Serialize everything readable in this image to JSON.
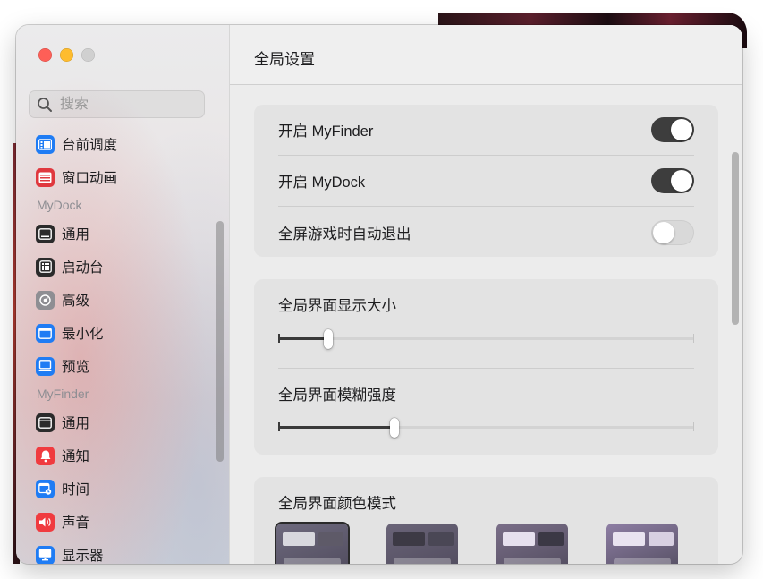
{
  "window": {
    "controls": [
      "close",
      "minimize",
      "zoom"
    ]
  },
  "sidebar": {
    "search_placeholder": "搜索",
    "items_top": [
      {
        "label": "台前调度",
        "icon": "stage-manager-icon",
        "color": "#1f7cf4"
      },
      {
        "label": "窗口动画",
        "icon": "window-animation-icon",
        "color": "#e0383e"
      }
    ],
    "section_dock": "MyDock",
    "items_dock": [
      {
        "label": "通用",
        "icon": "general-icon",
        "color": "#2b2b2b"
      },
      {
        "label": "启动台",
        "icon": "launchpad-icon",
        "color": "#2b2b2b"
      },
      {
        "label": "高级",
        "icon": "advanced-gear-icon",
        "color": "#8e8e93"
      },
      {
        "label": "最小化",
        "icon": "minimize-window-icon",
        "color": "#1f7cf4"
      },
      {
        "label": "预览",
        "icon": "preview-icon",
        "color": "#1f7cf4"
      }
    ],
    "section_finder": "MyFinder",
    "items_finder": [
      {
        "label": "通用",
        "icon": "general-icon",
        "color": "#2b2b2b"
      },
      {
        "label": "通知",
        "icon": "notification-bell-icon",
        "color": "#f03b3f"
      },
      {
        "label": "时间",
        "icon": "time-calendar-icon",
        "color": "#1f7cf4"
      },
      {
        "label": "声音",
        "icon": "sound-speaker-icon",
        "color": "#f03b3f"
      },
      {
        "label": "显示器",
        "icon": "display-monitor-icon",
        "color": "#1f7cf4"
      }
    ]
  },
  "header": {
    "title": "全局设置"
  },
  "toggles": [
    {
      "label": "开启 MyFinder",
      "on": true
    },
    {
      "label": "开启 MyDock",
      "on": true
    },
    {
      "label": "全屏游戏时自动退出",
      "on": false
    }
  ],
  "sliders": [
    {
      "label": "全局界面显示大小",
      "fraction": 0.12
    },
    {
      "label": "全局界面模糊强度",
      "fraction": 0.28
    }
  ],
  "color_mode": {
    "label": "全局界面颜色模式",
    "options": [
      {
        "name": "dark-translucent",
        "bg": "#6e6a7e",
        "w1": "#d8d8de",
        "w2": "#5e5a68",
        "selected": true
      },
      {
        "name": "dark",
        "bg": "#6a6478",
        "w1": "#3d3a45",
        "w2": "#4a4755",
        "selected": false
      },
      {
        "name": "mixed",
        "bg": "#7a6e88",
        "w1": "#e6e0ee",
        "w2": "#3b3845",
        "selected": false
      },
      {
        "name": "light",
        "bg": "#8e7ea4",
        "w1": "#e9e3f0",
        "w2": "#d8d0e2",
        "selected": false
      }
    ]
  }
}
